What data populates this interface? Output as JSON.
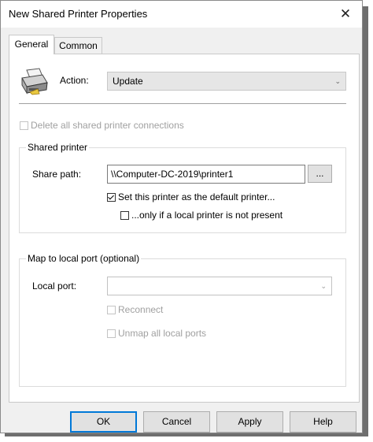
{
  "window": {
    "title": "New Shared Printer Properties",
    "close_glyph": "✕"
  },
  "tabs": [
    {
      "label": "General",
      "active": true
    },
    {
      "label": "Common",
      "active": false
    }
  ],
  "general": {
    "action_label": "Action:",
    "action_value": "Update",
    "delete_all_label": "Delete all shared printer connections",
    "shared_printer": {
      "legend": "Shared printer",
      "share_path_label": "Share path:",
      "share_path_value": "\\\\Computer-DC-2019\\printer1",
      "browse_label": "...",
      "set_default_label": "Set this printer as the default printer...",
      "only_if_label": "...only if a local printer is not present"
    },
    "map_local": {
      "legend": "Map to local port (optional)",
      "local_port_label": "Local port:",
      "local_port_value": "",
      "reconnect_label": "Reconnect",
      "unmap_label": "Unmap all local ports"
    }
  },
  "footer": {
    "ok": "OK",
    "cancel": "Cancel",
    "apply": "Apply",
    "help": "Help"
  },
  "icons": {
    "printer": "printer-icon",
    "close": "close-icon",
    "dropdown": "chevron-down-icon"
  },
  "colors": {
    "accent": "#0078d7",
    "dialog_bg": "#f0f0f0",
    "disabled_text": "#a0a0a0"
  }
}
